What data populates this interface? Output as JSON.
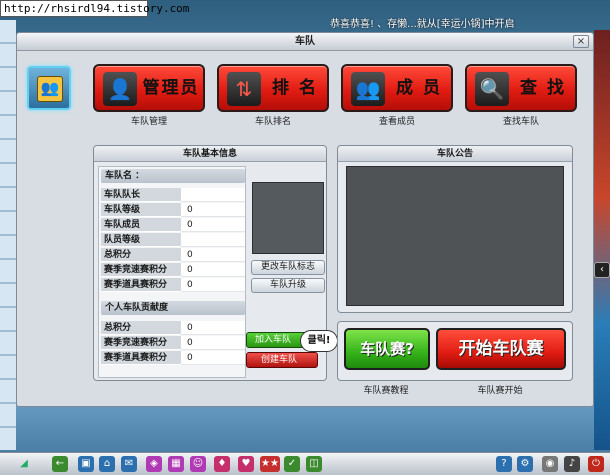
{
  "browser": {
    "url": "http://rhsirdl94.tistory.com"
  },
  "marquee": {
    "text": "恭喜恭喜! 、存懒...就从[幸运小锅]中开启"
  },
  "window": {
    "title": "车队",
    "close_glyph": "×"
  },
  "top_buttons": [
    {
      "label": "管理员",
      "caption": "车队管理",
      "icon": "person-icon"
    },
    {
      "label": "排 名",
      "caption": "车队排名",
      "icon": "up-down-arrows-icon"
    },
    {
      "label": "成 员",
      "caption": "查看成员",
      "icon": "group-icon"
    },
    {
      "label": "查 找",
      "caption": "查找车队",
      "icon": "magnifier-icon"
    }
  ],
  "info_panel": {
    "title": "车队基本信息",
    "name_label": "车队名 ：",
    "rows": [
      {
        "label": "车队队长",
        "value": ""
      },
      {
        "label": "车队等级",
        "value": "0"
      },
      {
        "label": "车队成员",
        "value": "0"
      },
      {
        "label": "队员等级",
        "value": ""
      },
      {
        "label": "总积分",
        "value": "0"
      },
      {
        "label": "赛季竞速赛积分",
        "value": "0"
      },
      {
        "label": "赛季道具赛积分",
        "value": "0"
      }
    ],
    "personal_title": "个人车队贡献度",
    "personal_rows": [
      {
        "label": "总积分",
        "value": "0"
      },
      {
        "label": "赛季竞速赛积分",
        "value": "0"
      },
      {
        "label": "赛季道具赛积分",
        "value": "0"
      }
    ],
    "change_emblem_button": "更改车队标志",
    "upgrade_button": "车队升级",
    "join_button": "加入车队",
    "create_button": "创建车队",
    "tooltip": "클릭!"
  },
  "notice_panel": {
    "title": "车队公告"
  },
  "match": {
    "tutorial_button": "车队赛?",
    "tutorial_caption": "车队赛教程",
    "start_button": "开始车队赛",
    "start_caption": "车队赛开始"
  },
  "colors": {
    "accent_red": "#e11c12",
    "accent_green": "#35b21a",
    "panel_bg": "#e6eaee"
  }
}
